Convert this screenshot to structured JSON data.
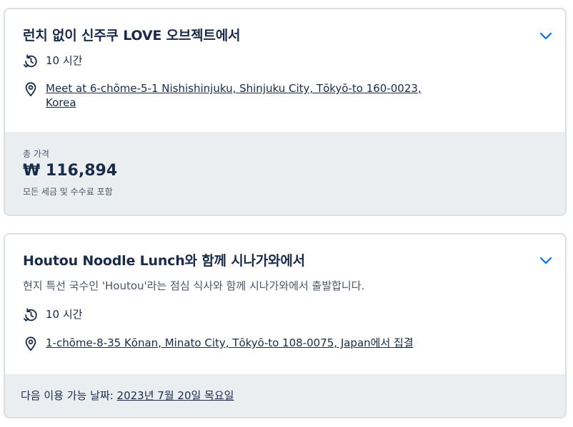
{
  "cards": [
    {
      "title": "런치 없이 신주쿠 LOVE 오브젝트에서",
      "duration": "10 시간",
      "meeting_point": "Meet at 6-chōme-5-1 Nishishinjuku, Shinjuku City, Tōkyō-to 160-0023,",
      "meeting_point_line2": "Korea",
      "price_label": "총 가격",
      "price": "₩ 116,894",
      "price_note": "모든 세금 및 수수료 포함"
    },
    {
      "title": "Houtou Noodle Lunch와 함께 시나가와에서",
      "description": "현지 특선 국수인 'Houtou'라는 점심 식사와 함께 시나가와에서 출발합니다.",
      "duration": "10 시간",
      "meeting_point": "1-chōme-8-35 Kōnan, Minato City, Tōkyō-to 108-0075, Japan에서 집결",
      "availability_label": "다음 이용 가능 날짜:",
      "availability_date": "2023년 7월 20일 목요일"
    }
  ],
  "colors": {
    "text": "#1a2b49",
    "accent": "#0071eb",
    "panel": "#ebeef1",
    "border": "#dcdfe4"
  },
  "icons": [
    "history-icon",
    "location-pin-icon",
    "chevron-down-icon"
  ]
}
